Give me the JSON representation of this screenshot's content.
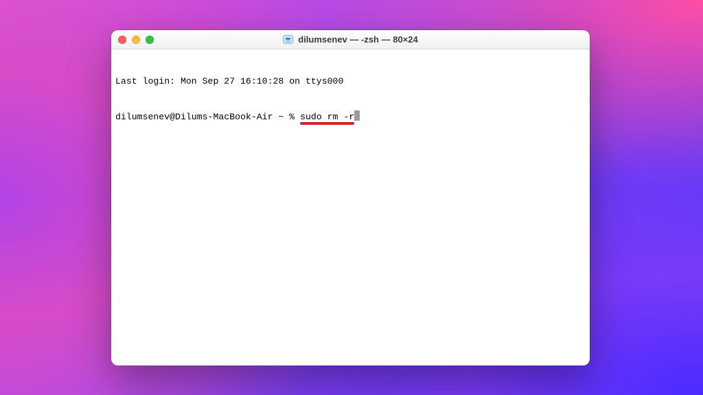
{
  "window": {
    "title": "dilumsenev — ‑zsh — 80×24"
  },
  "terminal": {
    "last_login_line": "Last login: Mon Sep 27 16:10:28 on ttys000",
    "prompt": "dilumsenev@Dilums-MacBook-Air ~ % ",
    "typed_command": "sudo rm -r"
  },
  "colors": {
    "traffic_red": "#ff5f57",
    "traffic_yellow": "#febc2e",
    "traffic_green": "#28c840",
    "annotation_underline": "#d2232a"
  }
}
